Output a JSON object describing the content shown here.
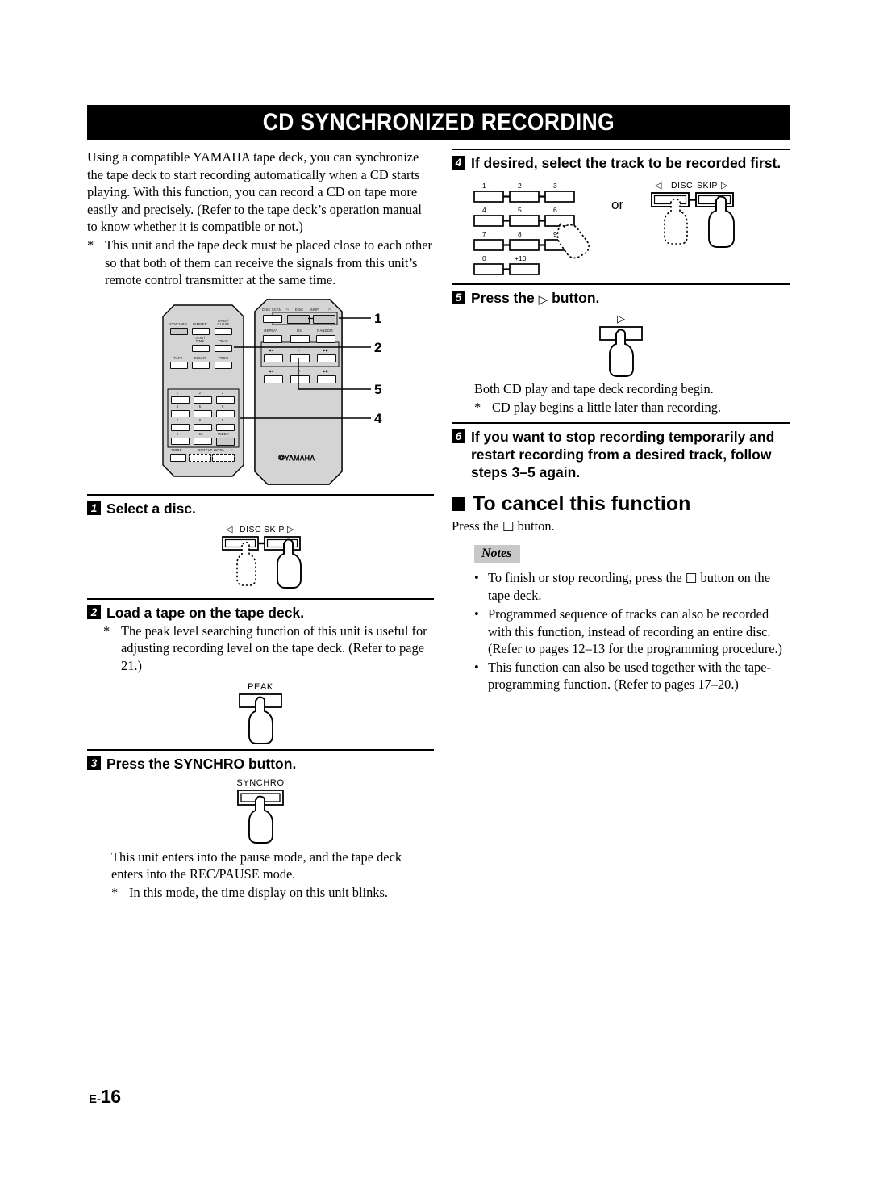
{
  "page": {
    "title": "CD SYNCHRONIZED RECORDING",
    "footer_prefix": "E-",
    "footer_number": "16"
  },
  "intro": {
    "paragraph": "Using a compatible YAMAHA tape deck, you can synchronize the tape deck to start recording automatically when a CD starts playing. With this function, you can record a CD on tape more easily and precisely. (Refer to the tape deck’s operation manual to know whether it is compatible or not.)",
    "note_mark": "*",
    "note": "This unit and the tape deck must be placed close to each other so that both of them can receive the signals from this unit’s remote control transmitter at the same time."
  },
  "remote": {
    "callouts": [
      "1",
      "2",
      "4",
      "5"
    ],
    "left_unit_labels": [
      "SYNCHRO",
      "DIMMER",
      "OPEN/",
      "CLOSE",
      "TEXT/",
      "TIME",
      "PEAK",
      "TAPE",
      "CLEAR",
      "PROG",
      "1",
      "2",
      "3",
      "4",
      "5",
      "6",
      "7",
      "8",
      "9",
      "0",
      "+10",
      "INDEX",
      "MODE",
      "–",
      "OUTPUT LEVEL",
      "+"
    ],
    "right_unit_labels": [
      "DISC SCAN",
      "DISC",
      "SKIP",
      "REPEAT",
      "DS",
      "RANDOM"
    ],
    "brand": "YAMAHA"
  },
  "steps": {
    "one": {
      "number": "1",
      "label": "Select a disc.",
      "figure_labels": {
        "disc": "DISC",
        "skip": "SKIP"
      }
    },
    "two": {
      "number": "2",
      "label": "Load a tape on the tape deck.",
      "note_mark": "*",
      "note": "The peak level searching function of this unit is useful for adjusting recording level on the tape deck. (Refer to page 21.)",
      "figure_label": "PEAK"
    },
    "three": {
      "number": "3",
      "label": "Press the SYNCHRO button.",
      "figure_label": "SYNCHRO",
      "body": "This unit enters into the pause mode, and the tape deck enters into the REC/PAUSE mode.",
      "note_mark": "*",
      "note": "In this mode, the time display on this unit blinks."
    },
    "four": {
      "number": "4",
      "label": "If desired, select the track to be recorded first.",
      "keypad": [
        "1",
        "2",
        "3",
        "4",
        "5",
        "6",
        "7",
        "8",
        "9",
        "0",
        "+10"
      ],
      "or_text": "or",
      "figure_labels": {
        "disc": "DISC",
        "skip": "SKIP"
      }
    },
    "five": {
      "number": "5",
      "label_before": "Press the",
      "label_after": "button.",
      "button_glyph": "play-triangle",
      "body": "Both CD play and tape deck recording begin.",
      "note_mark": "*",
      "note": "CD play begins a little later than recording."
    },
    "six": {
      "number": "6",
      "label": "If you want to stop recording temporarily and restart recording from a desired track, follow steps 3–5 again."
    }
  },
  "cancel_section": {
    "heading": "To cancel this function",
    "text_before": "Press the",
    "text_after": "button.",
    "button_glyph": "stop-square"
  },
  "notes": {
    "label": "Notes",
    "bullet": "•",
    "items": [
      {
        "before": "To finish or stop recording, press the",
        "glyph": "stop-square",
        "after": "button on the tape deck."
      },
      {
        "before": "Programmed sequence of tracks can also be recorded with this function, instead of recording an entire disc. (Refer to pages 12–13 for the programming procedure.)",
        "glyph": "",
        "after": ""
      },
      {
        "before": "This function can also be used together with the tape-programming function. (Refer to pages 17–20.)",
        "glyph": "",
        "after": ""
      }
    ]
  }
}
